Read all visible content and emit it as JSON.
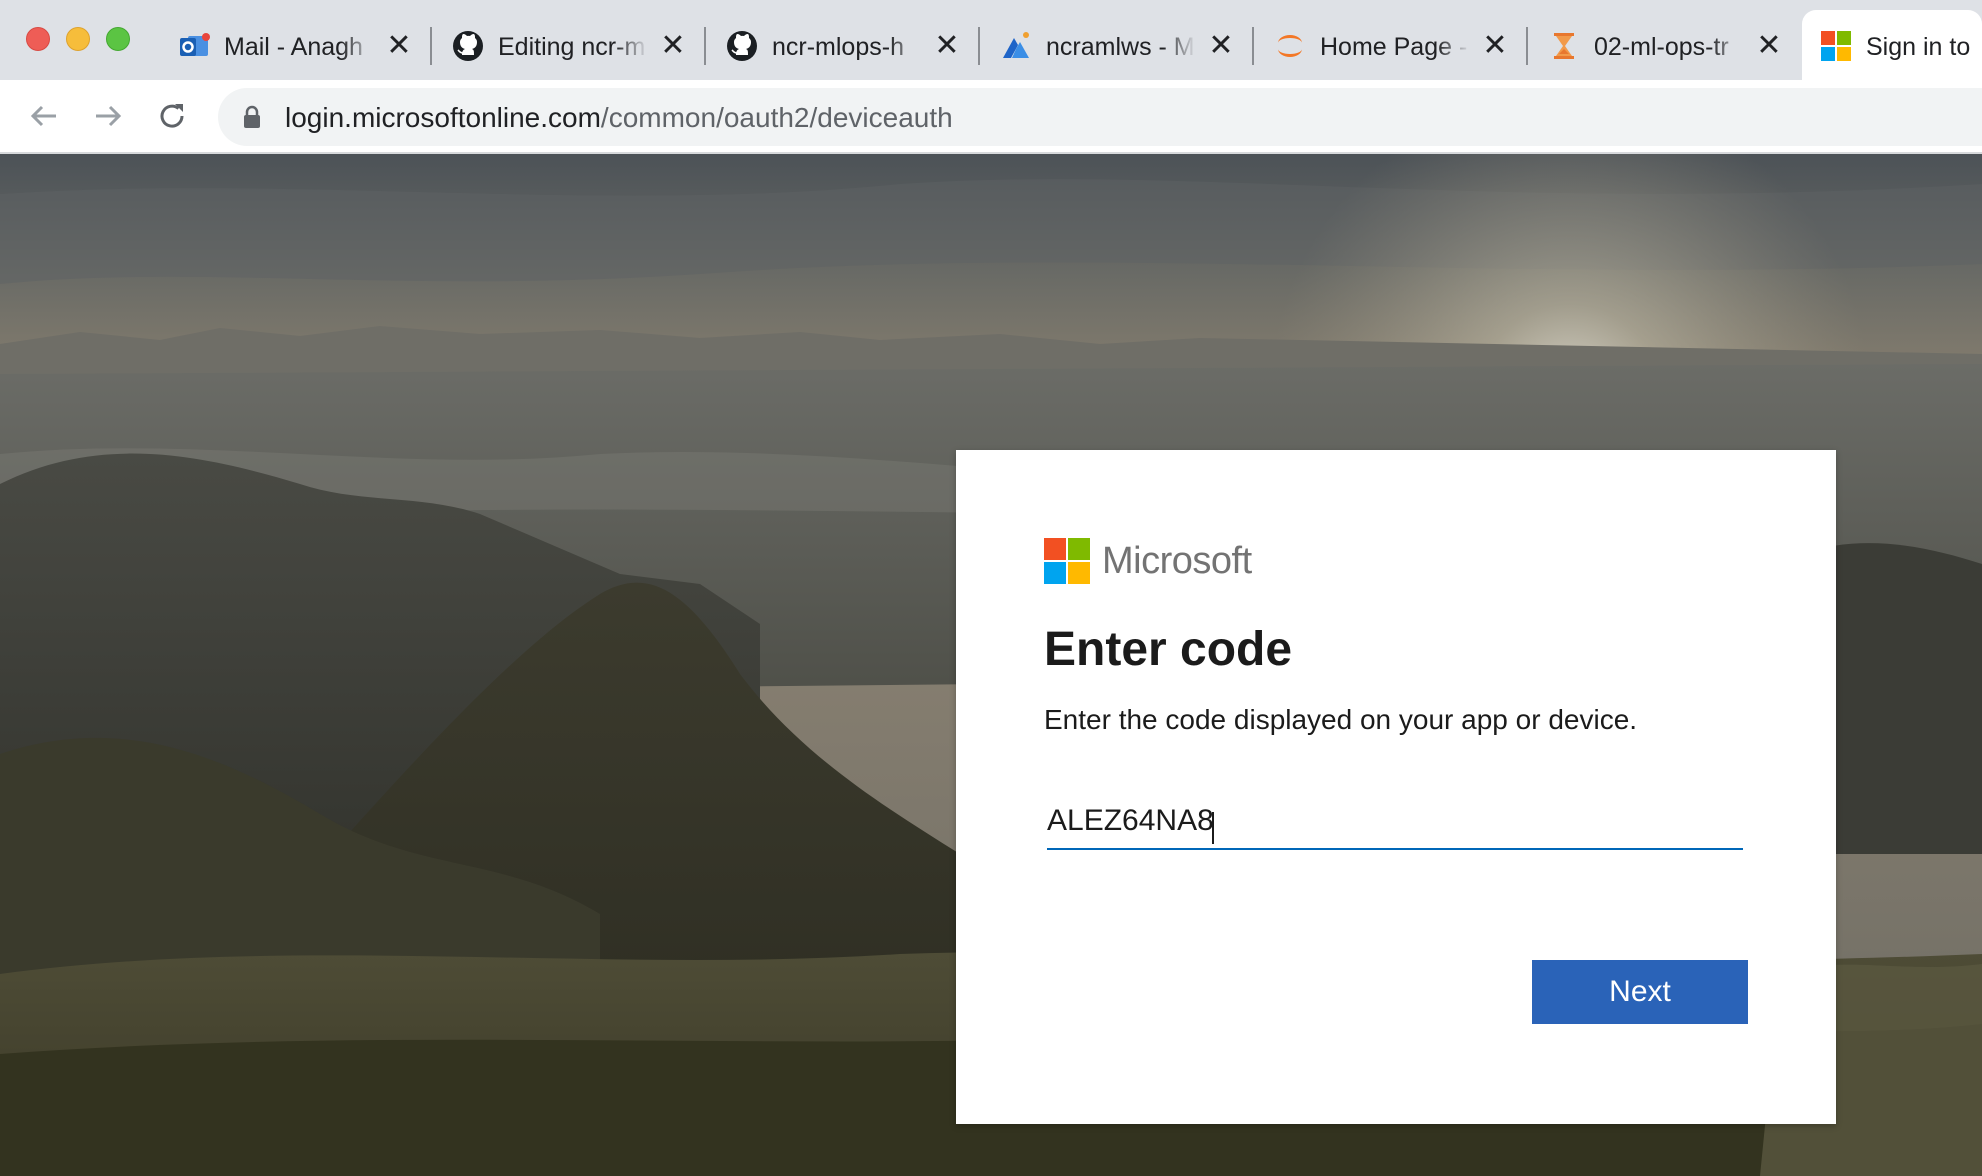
{
  "browser": {
    "tabs": [
      {
        "title": "Mail - Anagh",
        "icon": "outlook-icon",
        "close": "✕"
      },
      {
        "title": "Editing ncr-m",
        "icon": "github-icon",
        "close": "✕"
      },
      {
        "title": "ncr-mlops-h",
        "icon": "github-icon",
        "close": "✕"
      },
      {
        "title": "ncramlws - M",
        "icon": "azure-ml-icon",
        "close": "✕"
      },
      {
        "title": "Home Page -",
        "icon": "jupyter-icon",
        "close": "✕"
      },
      {
        "title": "02-ml-ops-tr",
        "icon": "hourglass-icon",
        "close": "✕"
      },
      {
        "title": "Sign in to",
        "icon": "microsoft-icon"
      }
    ],
    "url_host": "login.microsoftonline.com",
    "url_path": "/common/oauth2/deviceauth"
  },
  "login": {
    "brand": "Microsoft",
    "title": "Enter code",
    "description": "Enter the code displayed on your app or device.",
    "code_value": "ALEZ64NA8",
    "next_label": "Next"
  },
  "colors": {
    "ms_red": "#f25022",
    "ms_green": "#7fba00",
    "ms_blue": "#00a4ef",
    "ms_yellow": "#ffb900",
    "button_blue": "#2a63b8"
  }
}
